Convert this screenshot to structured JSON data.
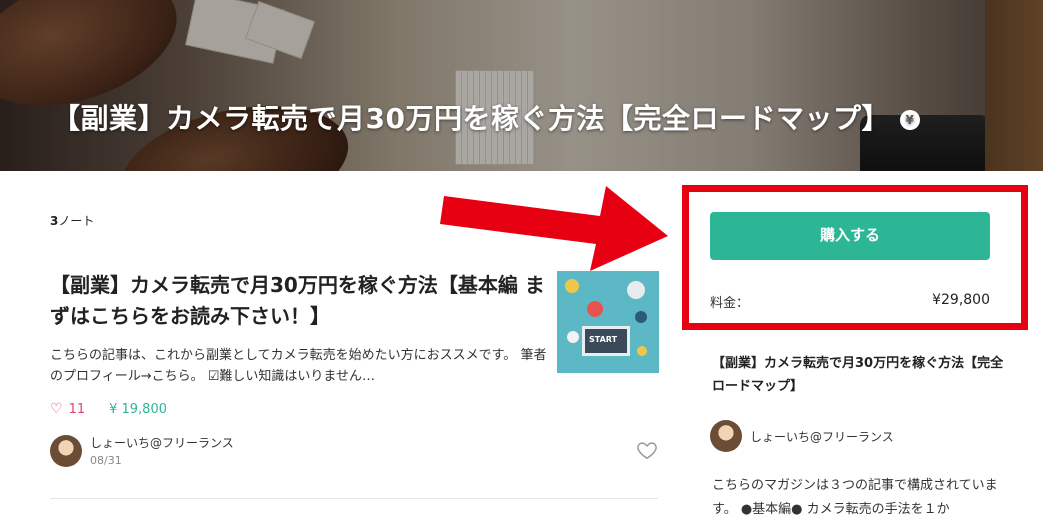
{
  "hero": {
    "title": "【副業】カメラ転売で月30万円を稼ぐ方法【完全ロードマップ】",
    "badge": "¥"
  },
  "note_count": {
    "number": "3",
    "unit": "ノート"
  },
  "article": {
    "title": "【副業】カメラ転売で月30万円を稼ぐ方法【基本編 まずはこちらをお読み下さい！】",
    "excerpt": "こちらの記事は、これから副業としてカメラ転売を始めたい方におススメです。 筆者のプロフィール→こちら。 ☑難しい知識はいりません…",
    "likes": "11",
    "price": "¥ 19,800",
    "author": "しょーいち@フリーランス",
    "date": "08/31",
    "thumbnail_text": "START"
  },
  "purchase": {
    "button_label": "購入する",
    "price_label": "料金：",
    "price_value": "¥29,800"
  },
  "magazine": {
    "title": "【副業】カメラ転売で月30万円を稼ぐ方法【完全ロードマップ】",
    "author": "しょーいち@フリーランス",
    "description": "こちらのマガジンは３つの記事で構成されています。 ●基本編● カメラ転売の手法を１か"
  },
  "colors": {
    "accent": "#2cb696",
    "highlight": "#e60012",
    "like": "#e0456a"
  }
}
